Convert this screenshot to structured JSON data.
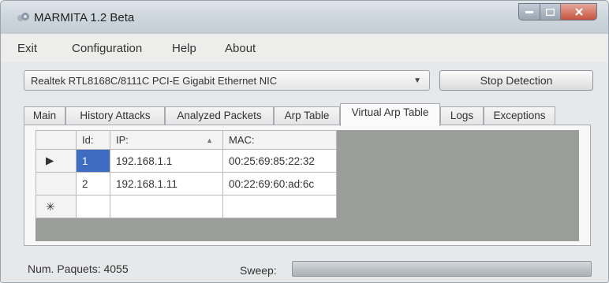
{
  "window": {
    "title": "MARMITA 1.2 Beta"
  },
  "menu": {
    "items": [
      "Exit",
      "Configuration",
      "Help",
      "About"
    ]
  },
  "toolbar": {
    "adapter_value": "Realtek RTL8168C/8111C PCI-E Gigabit Ethernet NIC",
    "stop_label": "Stop Detection"
  },
  "tabs": [
    {
      "label": "Main"
    },
    {
      "label": "History Attacks"
    },
    {
      "label": "Analyzed Packets"
    },
    {
      "label": "Arp Table"
    },
    {
      "label": "Virtual Arp Table",
      "active": true
    },
    {
      "label": "Logs"
    },
    {
      "label": "Exceptions"
    }
  ],
  "table": {
    "columns": [
      "Id:",
      "IP:",
      "MAC:"
    ],
    "rows": [
      {
        "id": "1",
        "ip": "192.168.1.1",
        "mac": "00:25:69:85:22:32"
      },
      {
        "id": "2",
        "ip": "192.168.1.11",
        "mac": "00:22:69:60:ad:6c"
      }
    ],
    "new_row_marker": "✳",
    "current_row_marker": "▶"
  },
  "status": {
    "packets_label": "Num. Paquets: 4055",
    "sweep_label": "Sweep:",
    "sweep_progress": 1.0
  },
  "colors": {
    "selection": "#3e6cc2",
    "grid_background": "#9b9d9a"
  }
}
